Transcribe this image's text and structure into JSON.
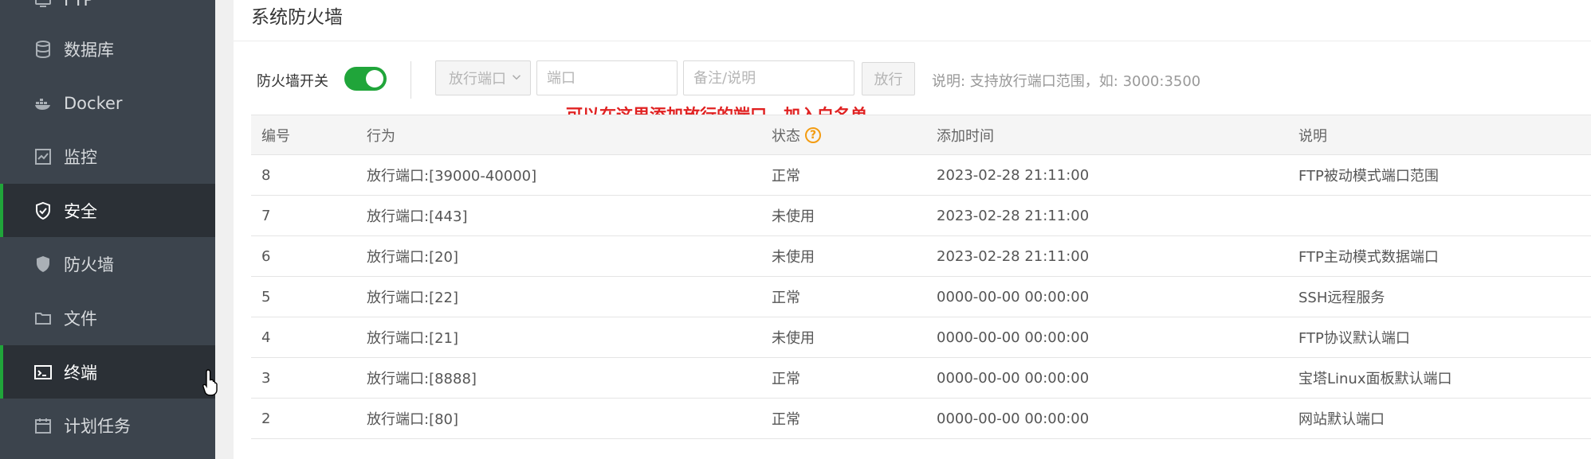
{
  "sidebar": {
    "items": [
      {
        "label": "FTP",
        "icon": "ftp-icon",
        "active": false
      },
      {
        "label": "数据库",
        "icon": "database-icon",
        "active": false
      },
      {
        "label": "Docker",
        "icon": "docker-icon",
        "active": false
      },
      {
        "label": "监控",
        "icon": "monitor-icon",
        "active": false
      },
      {
        "label": "安全",
        "icon": "shield-check-icon",
        "active": true
      },
      {
        "label": "防火墙",
        "icon": "shield-icon",
        "active": false
      },
      {
        "label": "文件",
        "icon": "folder-icon",
        "active": false
      },
      {
        "label": "终端",
        "icon": "terminal-icon",
        "active": true
      },
      {
        "label": "计划任务",
        "icon": "calendar-icon",
        "active": false
      }
    ]
  },
  "main": {
    "title": "系统防火墙",
    "firewall_switch_label": "防火墙开关",
    "firewall_enabled": true,
    "port_type_select": "放行端口",
    "port_input_placeholder": "端口",
    "note_input_placeholder": "备注/说明",
    "allow_button": "放行",
    "hint": "说明: 支持放行端口范围，如: 3000:3500",
    "annotation": "可以在这里添加放行的端口，加入白名单"
  },
  "table": {
    "headers": {
      "id": "编号",
      "action": "行为",
      "status": "状态",
      "time": "添加时间",
      "note": "说明"
    },
    "rows": [
      {
        "id": "8",
        "action": "放行端口:[39000-40000]",
        "status": "正常",
        "time": "2023-02-28 21:11:00",
        "note": "FTP被动模式端口范围"
      },
      {
        "id": "7",
        "action": "放行端口:[443]",
        "status": "未使用",
        "time": "2023-02-28 21:11:00",
        "note": ""
      },
      {
        "id": "6",
        "action": "放行端口:[20]",
        "status": "未使用",
        "time": "2023-02-28 21:11:00",
        "note": "FTP主动模式数据端口"
      },
      {
        "id": "5",
        "action": "放行端口:[22]",
        "status": "正常",
        "time": "0000-00-00 00:00:00",
        "note": "SSH远程服务"
      },
      {
        "id": "4",
        "action": "放行端口:[21]",
        "status": "未使用",
        "time": "0000-00-00 00:00:00",
        "note": "FTP协议默认端口"
      },
      {
        "id": "3",
        "action": "放行端口:[8888]",
        "status": "正常",
        "time": "0000-00-00 00:00:00",
        "note": "宝塔Linux面板默认端口"
      },
      {
        "id": "2",
        "action": "放行端口:[80]",
        "status": "正常",
        "time": "0000-00-00 00:00:00",
        "note": "网站默认端口"
      }
    ]
  },
  "colors": {
    "sidebar_bg": "#3c444d",
    "sidebar_active_bg": "#2b3036",
    "accent_green": "#20a53a",
    "annotation_red": "#e02222",
    "help_orange": "#f39c12"
  }
}
